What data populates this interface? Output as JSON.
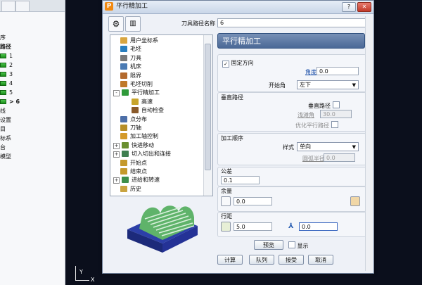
{
  "explorer": {
    "rows": [
      {
        "label": "序",
        "icon": false
      },
      {
        "label": "路径",
        "icon": false,
        "bold": true
      },
      {
        "label": "1",
        "icon": true
      },
      {
        "label": "2",
        "icon": true
      },
      {
        "label": "3",
        "icon": true
      },
      {
        "label": "4",
        "icon": true
      },
      {
        "label": "5",
        "icon": true
      },
      {
        "label": "> 6",
        "icon": true,
        "bold": true
      },
      {
        "label": "线",
        "icon": false
      },
      {
        "label": "设置",
        "icon": false
      },
      {
        "label": "目",
        "icon": false
      },
      {
        "label": "标系",
        "icon": false
      },
      {
        "label": "台",
        "icon": false
      },
      {
        "label": "模型",
        "icon": false
      }
    ]
  },
  "viewport": {
    "axis_y": "Y",
    "axis_x": "X"
  },
  "dialog": {
    "title": "平行精加工",
    "help_label": "?",
    "close_label": "✕",
    "toolpath_name_label": "刀具路径名称",
    "toolpath_name_value": "6",
    "tree": [
      {
        "label": "用户坐标系",
        "color": "#d9a640",
        "indent": 0,
        "exp": ""
      },
      {
        "label": "毛坯",
        "color": "#2a7fbf",
        "indent": 0,
        "exp": ""
      },
      {
        "label": "刀具",
        "color": "#7a7a7a",
        "indent": 0,
        "exp": ""
      },
      {
        "label": "机床",
        "color": "#4b7bb4",
        "indent": 0,
        "exp": ""
      },
      {
        "label": "限界",
        "color": "#b36a2e",
        "indent": 0,
        "exp": ""
      },
      {
        "label": "毛坯切削",
        "color": "#c07a2a",
        "indent": 0,
        "exp": ""
      },
      {
        "label": "平行精加工",
        "color": "#2f9a3a",
        "indent": 0,
        "exp": "-"
      },
      {
        "label": "高速",
        "color": "#c8a52c",
        "indent": 1,
        "exp": ""
      },
      {
        "label": "自动检查",
        "color": "#8a5a2a",
        "indent": 1,
        "exp": ""
      },
      {
        "label": "点分布",
        "color": "#4d6fa8",
        "indent": 0,
        "exp": ""
      },
      {
        "label": "刀轴",
        "color": "#b68e28",
        "indent": 0,
        "exp": ""
      },
      {
        "label": "加工轴控制",
        "color": "#d49a2a",
        "indent": 0,
        "exp": ""
      },
      {
        "label": "快进移动",
        "color": "#6a8f2f",
        "indent": 0,
        "exp": "+"
      },
      {
        "label": "切入切出和连接",
        "color": "#3f7f4f",
        "indent": 0,
        "exp": "+"
      },
      {
        "label": "开始点",
        "color": "#c59a2c",
        "indent": 0,
        "exp": ""
      },
      {
        "label": "结束点",
        "color": "#c59a2c",
        "indent": 0,
        "exp": ""
      },
      {
        "label": "进给和转速",
        "color": "#3d8f4a",
        "indent": 0,
        "exp": "+"
      },
      {
        "label": "历史",
        "color": "#c9a440",
        "indent": 0,
        "exp": ""
      }
    ],
    "page": {
      "title": "平行精加工",
      "fixed_direction_label": "固定方向",
      "angle_label": "角度",
      "angle_value": "0.0",
      "start_angle_label": "开始角",
      "start_angle_value": "左下",
      "perpendicular_group": "垂直路径",
      "perpendicular_path_label": "垂直路径",
      "shallow_angle_label": "浅滩角",
      "shallow_angle_value": "30.0",
      "optimize_label": "优化平行路径",
      "order_group": "加工顺序",
      "style_label": "样式",
      "style_value": "单向",
      "arc_radius_label": "圆弧半径",
      "arc_radius_value": "0.0",
      "tolerance_label": "公差",
      "tolerance_value": "0.1",
      "allowance_label": "余量",
      "allowance_value": "0.0",
      "stepover_label": "行距",
      "stepover_value": "5.0",
      "stepdown_value": "0.0",
      "preview_label": "预览",
      "show_label": "显示"
    },
    "buttons": {
      "calc": "计算",
      "queue": "队列",
      "accept": "接受",
      "cancel": "取消"
    }
  }
}
